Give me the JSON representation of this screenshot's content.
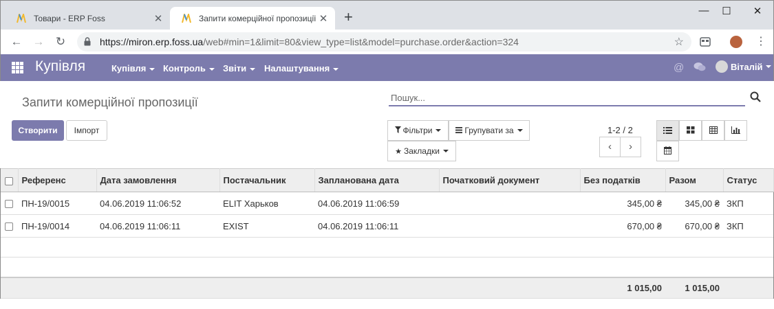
{
  "browser": {
    "tabs": [
      {
        "title": "Товари - ERP Foss",
        "active": false
      },
      {
        "title": "Запити комерційної пропозиції",
        "active": true
      }
    ],
    "url_host": "https://miron.erp.foss.ua",
    "url_path": "/web#min=1&limit=80&view_type=list&model=purchase.order&action=324",
    "window_controls": {
      "minimize": "—",
      "maximize": "☐",
      "close": "✕"
    }
  },
  "navbar": {
    "brand": "Купівля",
    "menus": [
      "Купівля",
      "Контроль",
      "Звіти",
      "Налаштування"
    ],
    "user": "Віталій",
    "color": "#7c7bad"
  },
  "control_panel": {
    "title": "Запити комерційної пропозиції",
    "search_placeholder": "Пошук...",
    "create_label": "Створити",
    "import_label": "Імпорт",
    "filters_label": "Фільтри",
    "group_by_label": "Групувати за",
    "favorites_label": "Закладки",
    "pager_value": "1-2 / 2"
  },
  "table": {
    "columns": [
      "Референс",
      "Дата замовлення",
      "Постачальник",
      "Запланована дата",
      "Початковий документ",
      "Без податків",
      "Разом",
      "Статус"
    ],
    "rows": [
      {
        "ref": "ПН-19/0015",
        "order_date": "04.06.2019 11:06:52",
        "vendor": "ELIT Харьков",
        "planned_date": "04.06.2019 11:06:59",
        "source": "",
        "untaxed": "345,00 ₴",
        "total": "345,00 ₴",
        "status": "ЗКП"
      },
      {
        "ref": "ПН-19/0014",
        "order_date": "04.06.2019 11:06:11",
        "vendor": "EXIST",
        "planned_date": "04.06.2019 11:06:11",
        "source": "",
        "untaxed": "670,00 ₴",
        "total": "670,00 ₴",
        "status": "ЗКП"
      }
    ],
    "footer": {
      "untaxed": "1 015,00",
      "total": "1 015,00"
    }
  }
}
